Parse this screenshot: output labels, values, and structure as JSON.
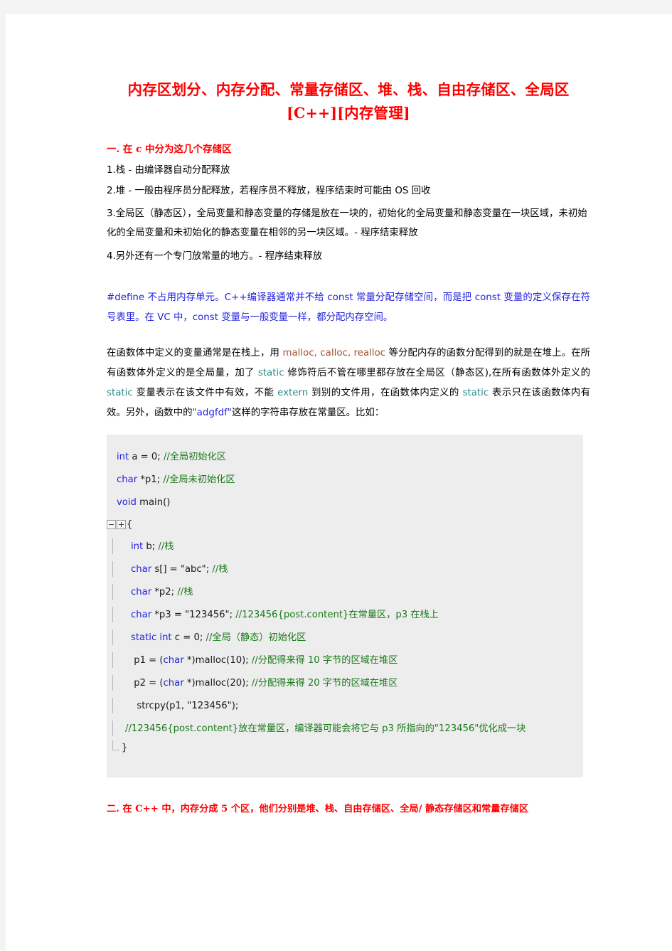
{
  "document": {
    "title_line_1": "内存区划分、内存分配、常量存储区、堆、栈、自由存储区、全局区",
    "title_line_2": "[C++][内存管理]",
    "section_one_heading": "一. 在 c 中分为这几个存储区",
    "items": [
      "1.栈 - 由编译器自动分配释放",
      "2.堆 - 一般由程序员分配释放，若程序员不释放，程序结束时可能由 OS 回收",
      "3.全局区（静态区），全局变量和静态变量的存储是放在一块的，初始化的全局变量和静态变量在一块区域，未初始化的全局变量和未初始化的静态变量在相邻的另一块区域。- 程序结束释放",
      "4.另外还有一个专门放常量的地方。- 程序结束释放"
    ],
    "blue_paragraph": {
      "p1": "#define 不占用内存单元。C++编译器通常并不给 const 常量分配存储空间，而是把 const 变量的定义保存在符号表里。在 VC 中，const 变量与一般变量一样，都分配内存空间。",
      "color": "#2323dd"
    },
    "main_paragraph": {
      "seg1": "在函数体中定义的变量通常是在栈上，用 ",
      "kw1": "malloc, calloc, realloc",
      "seg2": " 等分配内存的函数分配得到的就是在堆上。在所有函数体外定义的是全局量，加了 ",
      "kw2": "static",
      "seg3": " 修饰符后不管在哪里都存放在全局区（静态区),在所有函数体外定义的 ",
      "kw3": "static",
      "seg4": " 变量表示在该文件中有效，不能 ",
      "kw4": "extern",
      "seg5": " 到别的文件用，在函数体内定义的 ",
      "kw5": "static",
      "seg6": " 表示只在该函数体内有效。另外，函数中的",
      "kw6": "\"adgfdf\"",
      "seg7": "这样的字符串存放在常量区。比如：",
      "kw_color_brown": "#a0522d",
      "kw_color_teal": "#2e8b8b",
      "kw_color_blue": "#2323dd"
    },
    "code": {
      "background": "#ededed",
      "keyword_color": "#2323dd",
      "comment_color": "#1a7a1a",
      "lines": [
        {
          "kw": "int",
          "plain": " a = 0; ",
          "comment": "//全局初始化区"
        },
        {
          "kw": "char",
          "plain": " *p1; ",
          "comment": "//全局未初始化区"
        },
        {
          "kw": "void",
          "plain": " main()",
          "comment": ""
        }
      ],
      "open_brace": "{",
      "body_lines": [
        {
          "kw": "int",
          "plain": " b; ",
          "comment": "//栈"
        },
        {
          "kw": "char",
          "plain": " s[] = \"abc\"; ",
          "comment": "//栈"
        },
        {
          "kw": "char",
          "plain": " *p2; ",
          "comment": "//栈"
        },
        {
          "kw": "char",
          "plain": " *p3 = \"123456\"; ",
          "comment": "//123456{post.content}在常量区，p3 在栈上"
        },
        {
          "kw": "static int",
          "plain": " c = 0; ",
          "comment": "//全局（静态）初始化区"
        }
      ],
      "alloc_lines": [
        {
          "pre": " p1 = (",
          "kw": "char",
          "post": " *)malloc(10); ",
          "comment": "//分配得来得 10 字节的区域在堆区"
        },
        {
          "pre": " p2 = (",
          "kw": "char",
          "post": " *)malloc(20); ",
          "comment": "//分配得来得 20 字节的区域在堆区"
        }
      ],
      "strcpy_line": "  strcpy(p1, \"123456\");",
      "final_comment": "//123456{post.content}放在常量区，编译器可能会将它与 p3 所指向的\"123456\"优化成一块",
      "close_brace": "}"
    },
    "section_two_heading": "二. 在 C++ 中，内存分成 5 个区，他们分别是堆、栈、自由存储区、全局/ 静态存储区和常量存储区",
    "heading_color": "#ff0000"
  }
}
